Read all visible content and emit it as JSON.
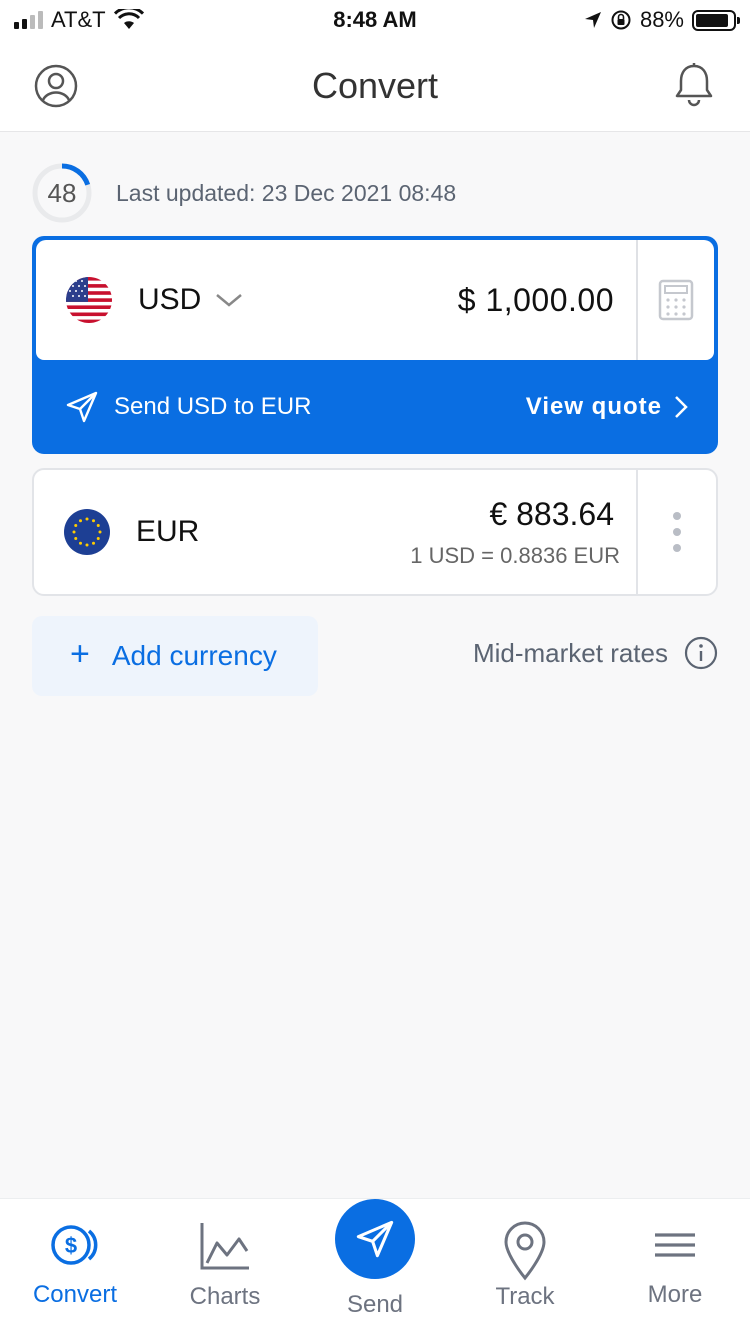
{
  "status_bar": {
    "carrier": "AT&T",
    "time": "8:48 AM",
    "battery": "88%",
    "battery_level": 0.88,
    "icons": [
      "signal-icon",
      "wifi-icon",
      "location-arrow-icon",
      "orientation-lock-icon",
      "battery-icon"
    ]
  },
  "header": {
    "title": "Convert",
    "left_icon": "profile-icon",
    "right_icon": "bell-icon"
  },
  "refresh": {
    "countdown": "48",
    "progress": 0.2,
    "last_updated": "Last updated: 23 Dec 2021 08:48"
  },
  "source": {
    "currency": "USD",
    "amount": "$ 1,000.00",
    "flag_icon": "us-flag-icon",
    "calculator_icon": "calculator-icon",
    "send_label": "Send USD to EUR",
    "view_quote_label": "View quote"
  },
  "targets": [
    {
      "currency": "EUR",
      "amount": "€ 883.64",
      "rate": "1 USD = 0.8836 EUR",
      "flag_icon": "eu-flag-icon"
    }
  ],
  "actions": {
    "add_currency_label": "Add currency",
    "mid_market_label": "Mid-market rates"
  },
  "tabs": [
    {
      "label": "Convert",
      "icon": "dollar-coin-icon",
      "active": true
    },
    {
      "label": "Charts",
      "icon": "chart-line-icon",
      "active": false
    },
    {
      "label": "Send",
      "icon": "paper-plane-icon",
      "active": false
    },
    {
      "label": "Track",
      "icon": "location-pin-icon",
      "active": false
    },
    {
      "label": "More",
      "icon": "hamburger-menu-icon",
      "active": false
    }
  ],
  "colors": {
    "accent": "#0a6ee2",
    "accent_light": "#eef4fc",
    "text_muted": "#5b6472",
    "background": "#f8f8f9"
  }
}
